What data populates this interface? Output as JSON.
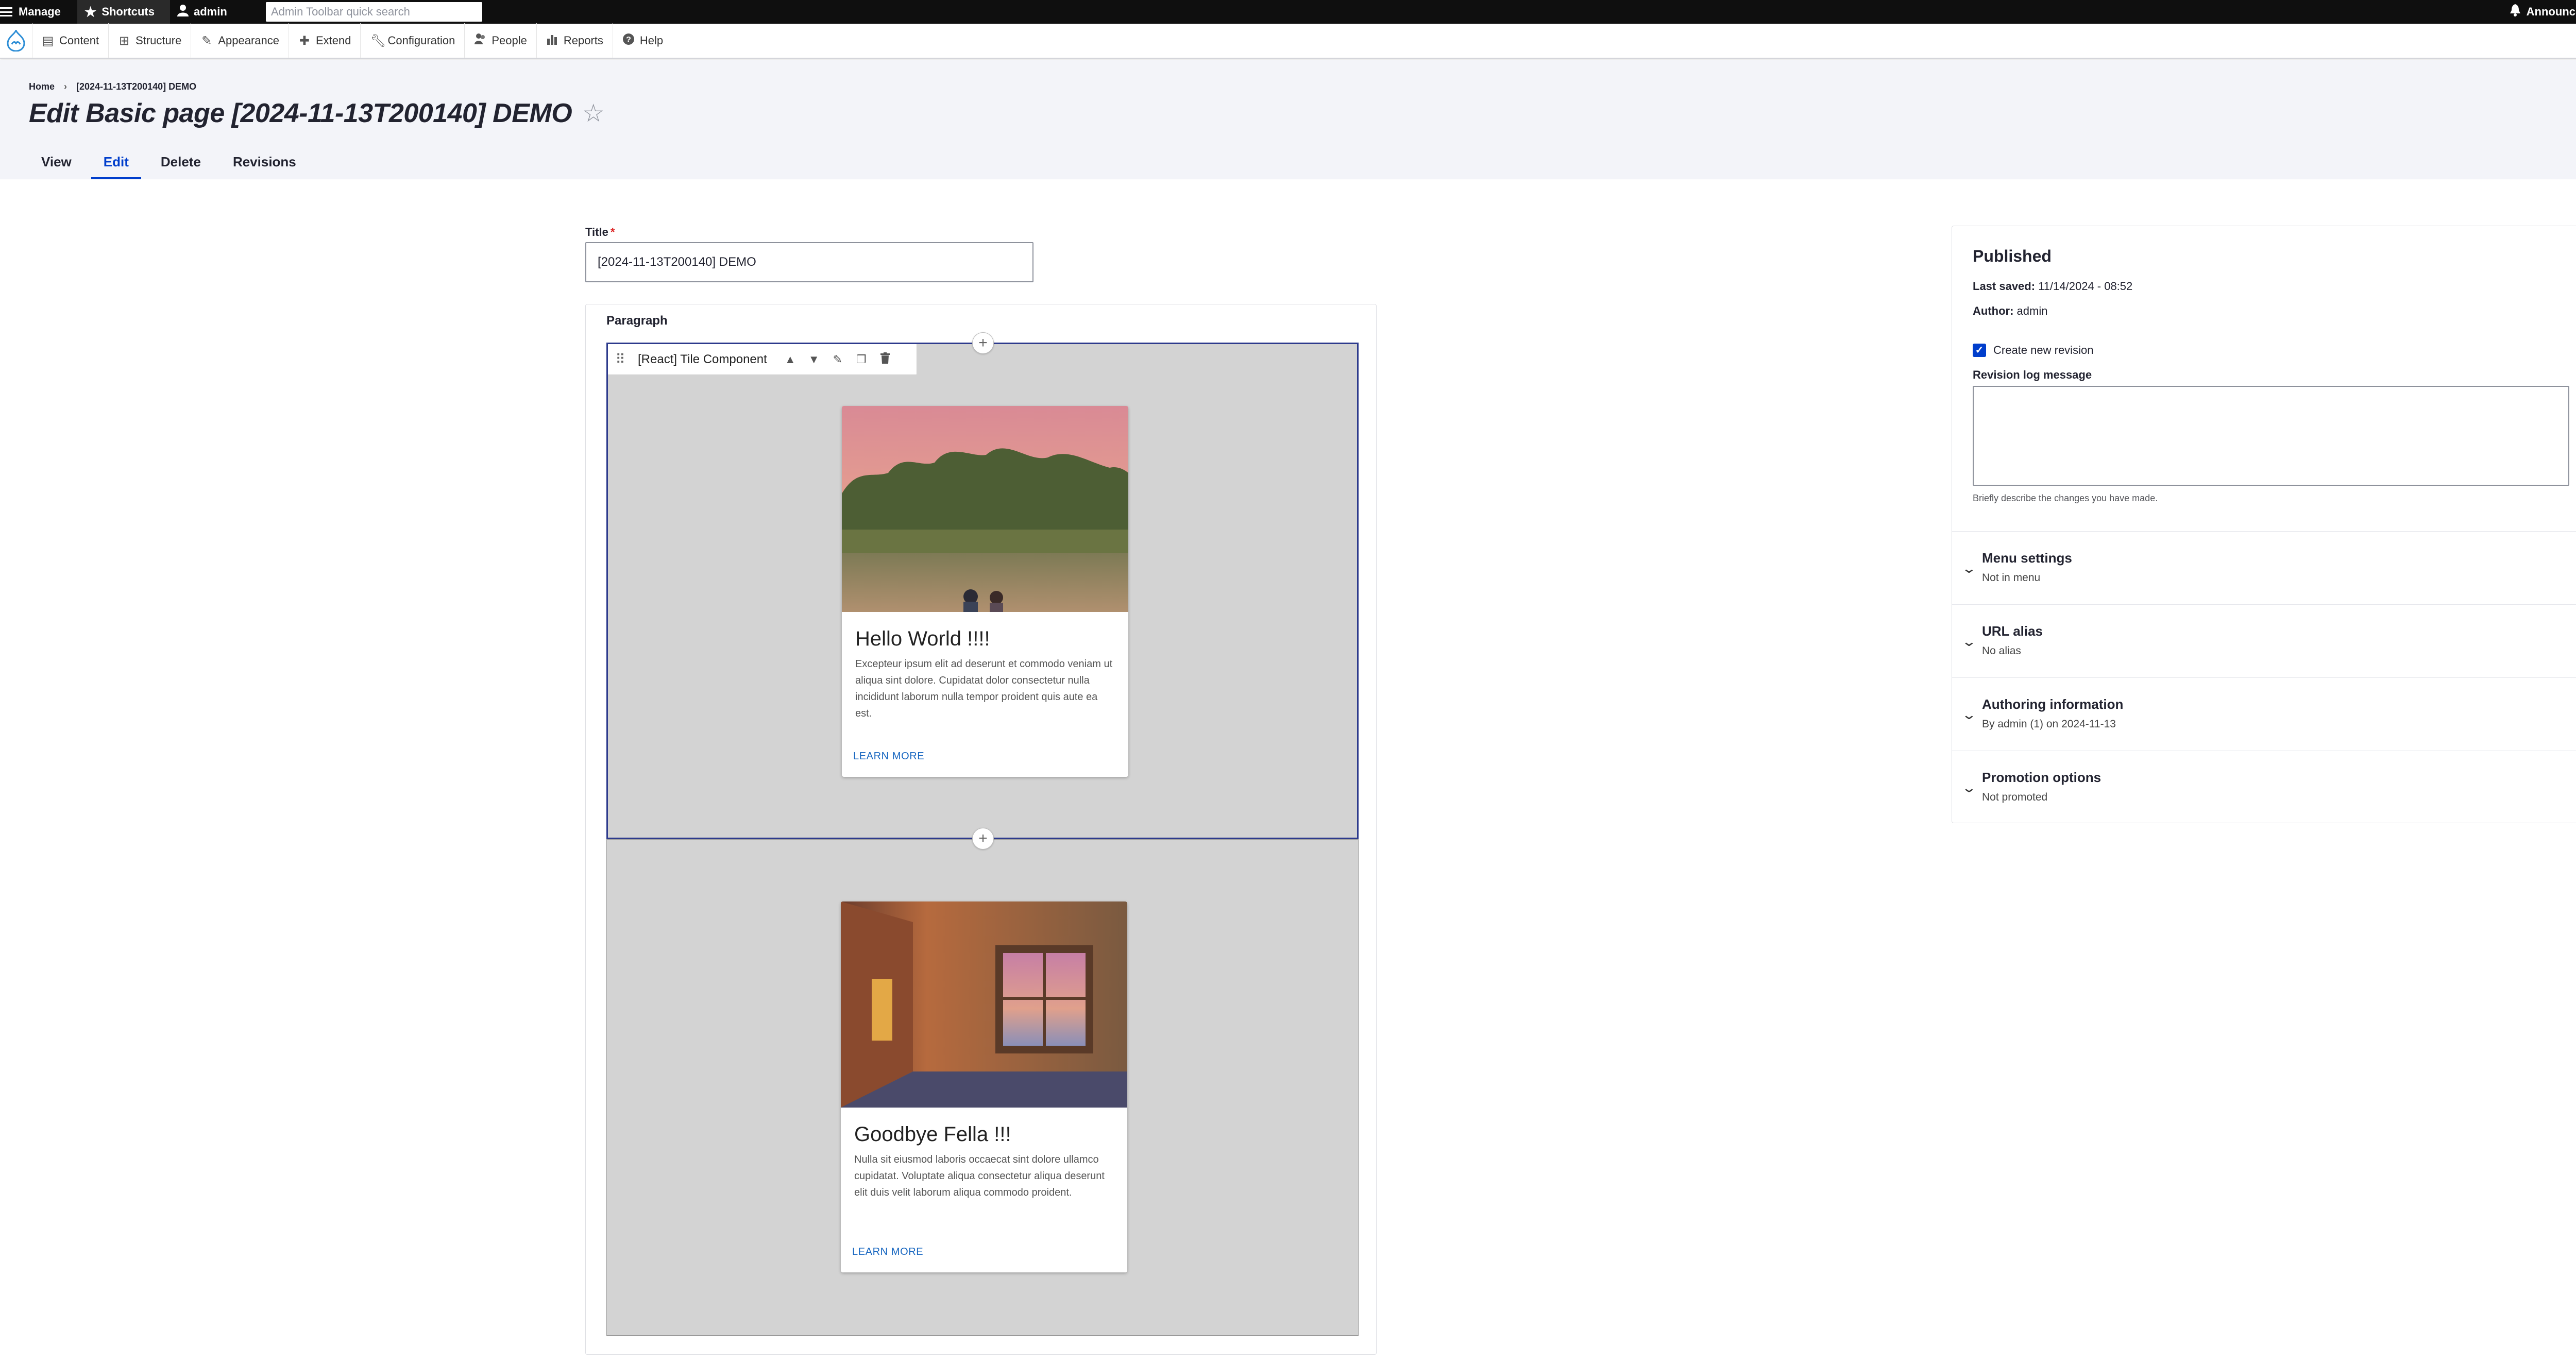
{
  "toolbar": {
    "manage": "Manage",
    "shortcuts": "Shortcuts",
    "user": "admin",
    "search_placeholder": "Admin Toolbar quick search",
    "announcements": "Announcements"
  },
  "admin_menu": {
    "items": [
      {
        "label": "Content",
        "icon": "content-icon"
      },
      {
        "label": "Structure",
        "icon": "structure-icon"
      },
      {
        "label": "Appearance",
        "icon": "appearance-icon"
      },
      {
        "label": "Extend",
        "icon": "extend-icon"
      },
      {
        "label": "Configuration",
        "icon": "wrench-icon"
      },
      {
        "label": "People",
        "icon": "people-icon"
      },
      {
        "label": "Reports",
        "icon": "reports-icon"
      },
      {
        "label": "Help",
        "icon": "help-icon"
      }
    ]
  },
  "breadcrumb": {
    "home": "Home",
    "separator": "›",
    "current": "[2024-11-13T200140] DEMO"
  },
  "page": {
    "title": "Edit Basic page [2024-11-13T200140] DEMO"
  },
  "tabs": [
    {
      "label": "View",
      "active": false
    },
    {
      "label": "Edit",
      "active": true
    },
    {
      "label": "Delete",
      "active": false
    },
    {
      "label": "Revisions",
      "active": false
    }
  ],
  "form": {
    "title_label": "Title",
    "required_marker": "*",
    "title_value": "[2024-11-13T200140] DEMO",
    "paragraph_label": "Paragraph",
    "component_name": "[React] Tile Component",
    "add_symbol": "+"
  },
  "cards": [
    {
      "title": "Hello World !!!!",
      "text": "Excepteur ipsum elit ad deserunt et commodo veniam ut aliqua sint dolore. Cupidatat dolor consectetur nulla incididunt laborum nulla tempor proident quis aute ea est.",
      "link": "LEARN MORE"
    },
    {
      "title": "Goodbye Fella !!!",
      "text": "Nulla sit eiusmod laboris occaecat sint dolore ullamco cupidatat. Voluptate aliqua consectetur aliqua deserunt elit duis velit laborum aliqua commodo proident.",
      "link": "LEARN MORE"
    }
  ],
  "sidebar": {
    "status": "Published",
    "last_saved_label": "Last saved:",
    "last_saved_value": "11/14/2024 - 08:52",
    "author_label": "Author:",
    "author_value": "admin",
    "create_revision_label": "Create new revision",
    "revision_log_label": "Revision log message",
    "revision_help": "Briefly describe the changes you have made.",
    "sections": [
      {
        "title": "Menu settings",
        "summary": "Not in menu"
      },
      {
        "title": "URL alias",
        "summary": "No alias"
      },
      {
        "title": "Authoring information",
        "summary": "By admin (1) on 2024-11-13"
      },
      {
        "title": "Promotion options",
        "summary": "Not promoted"
      }
    ]
  },
  "colors": {
    "accent": "#003ecc",
    "toolbar_bg": "#0f0f0f",
    "header_bg": "#f3f4f9",
    "component_bg": "#d3d3d3"
  }
}
